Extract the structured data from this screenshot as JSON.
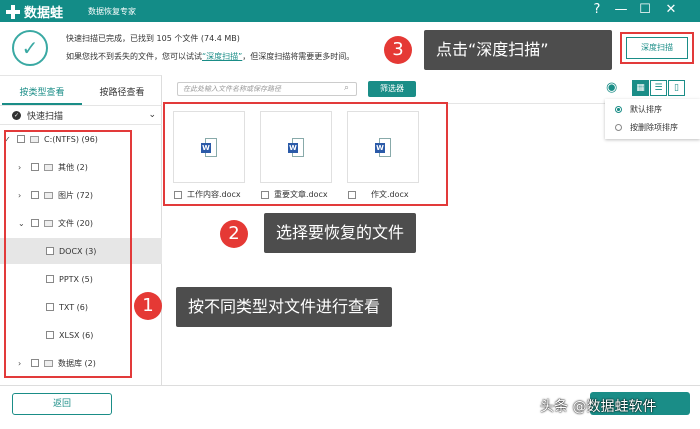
{
  "app": {
    "name": "数据蛙",
    "subtitle": "数据恢复专家"
  },
  "window": {
    "help": "?",
    "minimize": "—",
    "maximize": "☐",
    "close": "✕"
  },
  "status": {
    "line1": "快速扫描已完成，已找到 105 个文件 (74.4 MB)",
    "line2_pre": "如果您找不到丢失的文件，您可以试试",
    "line2_link": "“深度扫描”",
    "line2_post": "，但深度扫描将需要更多时间。"
  },
  "deep_scan_label": "深度扫描",
  "tabs": [
    {
      "label": "按类型查看"
    },
    {
      "label": "按路径查看"
    }
  ],
  "quick_scan": "快速扫描",
  "tree": [
    {
      "label": "C:(NTFS) (96)",
      "arrow": "✓"
    },
    {
      "label": "其他 (2)",
      "arrow": "›"
    },
    {
      "label": "图片 (72)",
      "arrow": "›"
    },
    {
      "label": "文件 (20)",
      "arrow": "⌄"
    },
    {
      "label": "DOCX (3)"
    },
    {
      "label": "PPTX (5)"
    },
    {
      "label": "TXT (6)"
    },
    {
      "label": "XLSX (6)"
    },
    {
      "label": "数据库 (2)",
      "arrow": "›"
    }
  ],
  "search": {
    "placeholder": "在此处输入文件名称或保存路径"
  },
  "filter_label": "筛选器",
  "files": [
    {
      "name": "工作内容.docx"
    },
    {
      "name": "重要文章.docx"
    },
    {
      "name": "作文.docx"
    }
  ],
  "sort": {
    "options": [
      {
        "label": "默认排序",
        "selected": true
      },
      {
        "label": "按删除项排序",
        "selected": false
      }
    ]
  },
  "back_label": "返回",
  "watermark": "头条 @数据蛙软件",
  "callouts": [
    {
      "num": "1",
      "text": "按不同类型对文件进行查看"
    },
    {
      "num": "2",
      "text": "选择要恢复的文件"
    },
    {
      "num": "3",
      "text": "点击“深度扫描”"
    }
  ],
  "colors": {
    "brand": "#1a8d87",
    "highlight": "#e23a3a",
    "callout": "#4d4d4d"
  }
}
